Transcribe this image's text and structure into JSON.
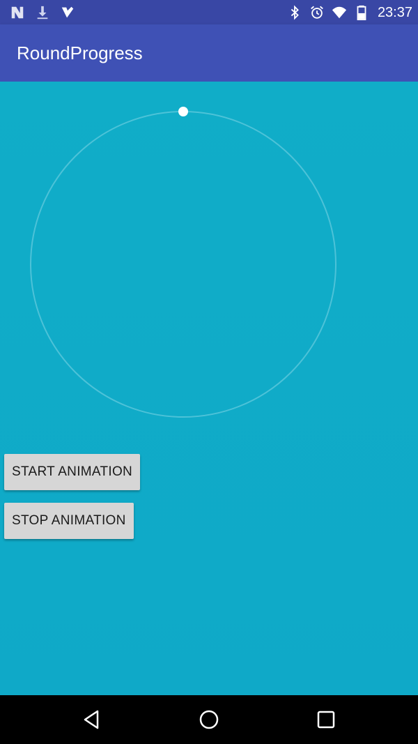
{
  "status_bar": {
    "left_icons": [
      "n-icon",
      "download-icon",
      "check-icon"
    ],
    "right_icons": [
      "bluetooth-icon",
      "alarm-icon",
      "wifi-icon",
      "battery-icon"
    ],
    "time": "23:37"
  },
  "app_bar": {
    "title": "RoundProgress"
  },
  "round_progress": {
    "progress": 0,
    "ring_color": "#5cc8dc",
    "dot_color": "#ffffff"
  },
  "buttons": {
    "start_label": "START ANIMATION",
    "stop_label": "STOP ANIMATION"
  },
  "nav_bar": {
    "icons": [
      "back-icon",
      "home-icon",
      "recents-icon"
    ]
  }
}
